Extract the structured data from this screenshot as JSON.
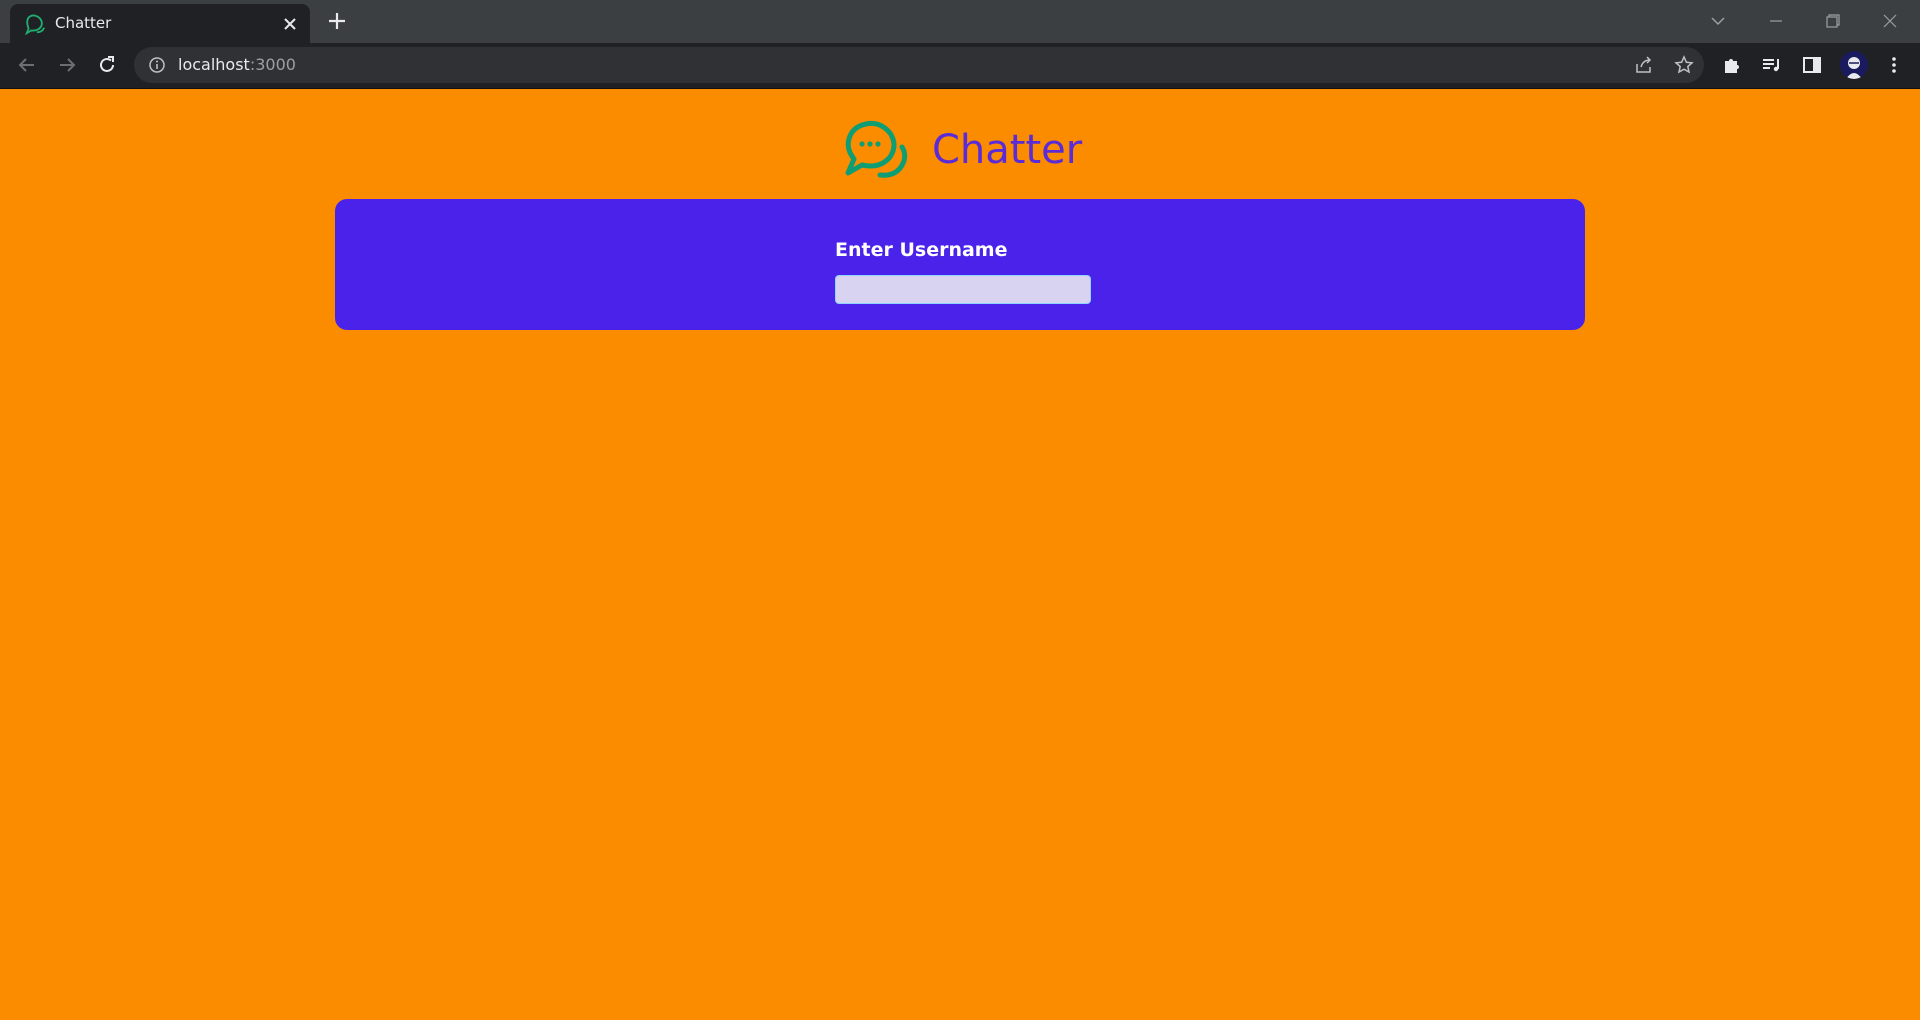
{
  "browser": {
    "tab": {
      "title": "Chatter",
      "favicon": "chat-bubbles-icon"
    },
    "toolbar": {
      "url_host": "localhost",
      "url_port": ":3000",
      "icons": [
        "back-arrow-icon",
        "forward-arrow-icon",
        "reload-icon",
        "site-info-icon",
        "share-icon",
        "bookmark-star-icon",
        "extensions-icon",
        "media-queue-icon",
        "side-panel-icon",
        "avatar",
        "kebab-menu-icon"
      ]
    }
  },
  "page": {
    "brand": {
      "name": "Chatter",
      "logo": "chat-bubbles-icon"
    },
    "login": {
      "label": "Enter Username",
      "input_value": "",
      "input_placeholder": ""
    }
  },
  "colors": {
    "page_background": "#fb8c00",
    "card_background": "#4a22ea",
    "brand_text": "#5b2bd8",
    "logo": "#0f9d73",
    "input_background": "#d7d3f0"
  }
}
